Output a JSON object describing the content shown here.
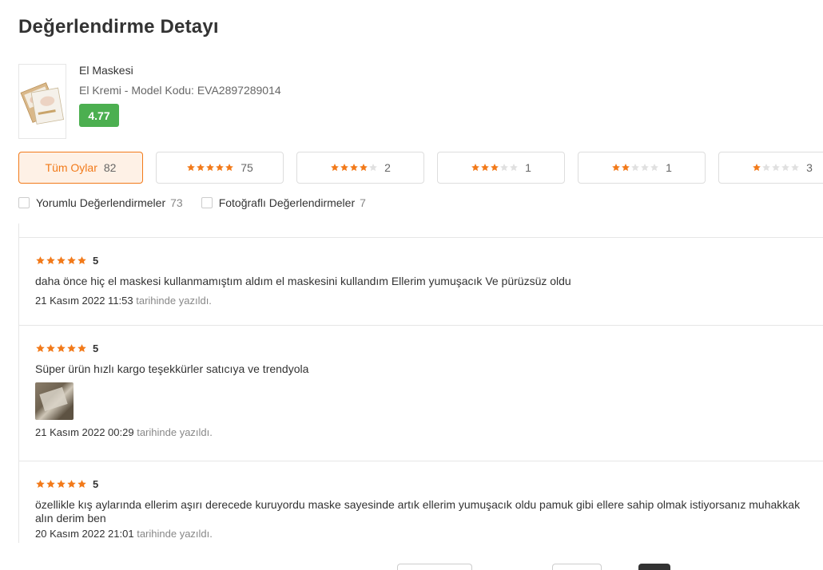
{
  "page": {
    "title": "Değerlendirme Detayı"
  },
  "product": {
    "name": "El Maskesi",
    "subtitle": "El Kremi - Model Kodu: EVA2897289014",
    "rating": "4.77"
  },
  "filters": [
    {
      "label": "Tüm Oylar",
      "count": "82",
      "stars": 0,
      "active": true
    },
    {
      "label": "",
      "count": "75",
      "stars": 5
    },
    {
      "label": "",
      "count": "2",
      "stars": 4
    },
    {
      "label": "",
      "count": "1",
      "stars": 3
    },
    {
      "label": "",
      "count": "1",
      "stars": 2
    },
    {
      "label": "",
      "count": "3",
      "stars": 1
    }
  ],
  "checkboxes": [
    {
      "label": "Yorumlu Değerlendirmeler",
      "count": "73"
    },
    {
      "label": "Fotoğraflı Değerlendirmeler",
      "count": "7"
    }
  ],
  "reviews": [
    {
      "score": "5",
      "text": "daha önce hiç el maskesi kullanmamıştım aldım el maskesini kullandım Ellerim yumuşacık Ve pürüzsüz oldu",
      "date": "21 Kasım 2022 11:53",
      "date_suffix": "tarihinde yazıldı."
    },
    {
      "score": "5",
      "text": "Süper ürün hızlı kargo teşekkürler satıcıya ve trendyola",
      "date": "21 Kasım 2022 00:29",
      "date_suffix": "tarihinde yazıldı."
    },
    {
      "score": "5",
      "text": "özellikle kış aylarında ellerim aşırı derecede kuruyordu maske sayesinde artık ellerim yumuşacık oldu pamuk gibi ellere sahip olmak istiyorsanız muhakkak alın derim ben",
      "date": "20 Kasım 2022 21:01",
      "date_suffix": "tarihinde yazıldı."
    }
  ],
  "colors": {
    "accent": "#f27a1a",
    "star": "#f27a1a",
    "star_empty": "#e0e0e0",
    "rating_badge": "#4caf50"
  },
  "icons": {
    "star": "star-icon",
    "checkbox": "checkbox-icon"
  }
}
